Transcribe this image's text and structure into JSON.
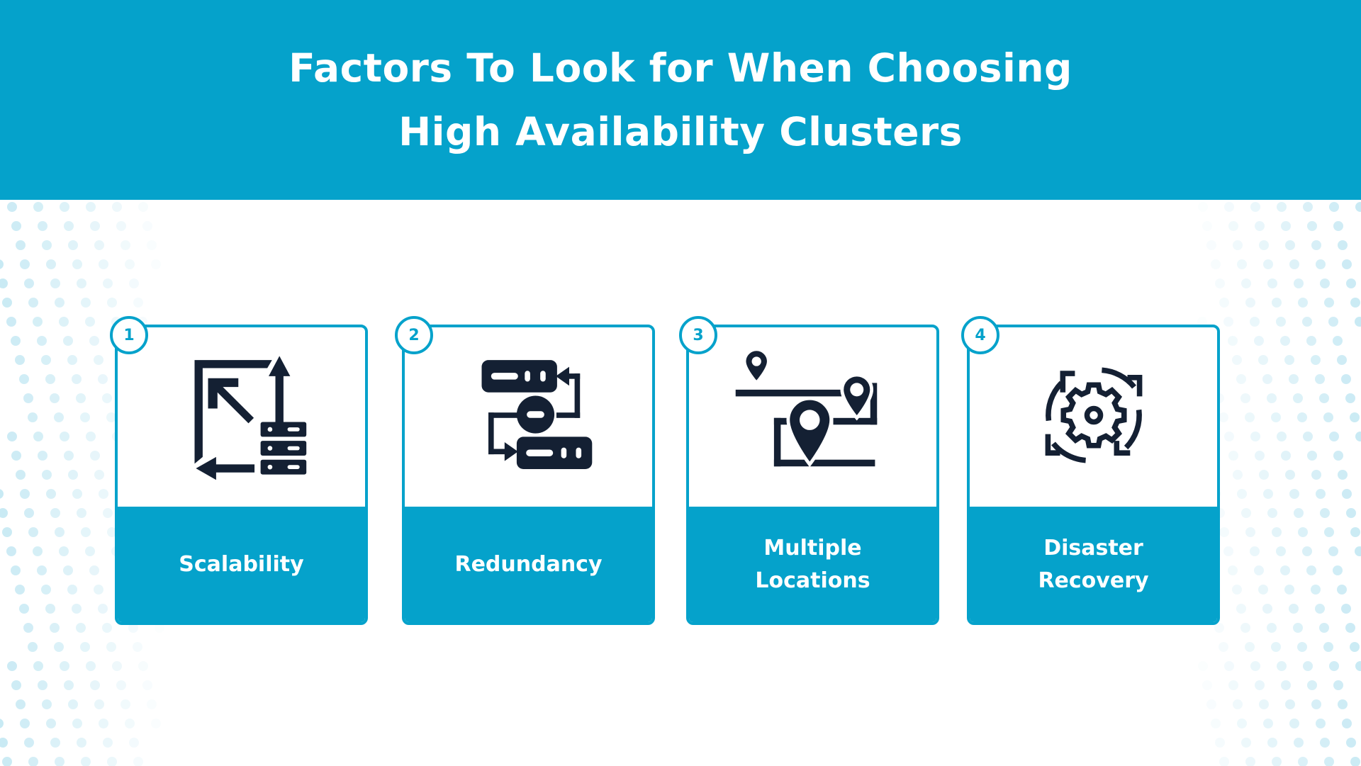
{
  "header": {
    "title_line1": "Factors To Look for When Choosing",
    "title_line2": "High Availability Clusters"
  },
  "colors": {
    "brand": "#05A2CB",
    "icon": "#142033",
    "dots": "#BFE6F2"
  },
  "factors": [
    {
      "number": "1",
      "label": "Scalability",
      "icon": "scale-servers-icon"
    },
    {
      "number": "2",
      "label": "Redundancy",
      "icon": "redundant-servers-icon"
    },
    {
      "number": "3",
      "label": "Multiple\nLocations",
      "icon": "map-pins-icon"
    },
    {
      "number": "4",
      "label": "Disaster\nRecovery",
      "icon": "gear-cycle-icon"
    }
  ]
}
